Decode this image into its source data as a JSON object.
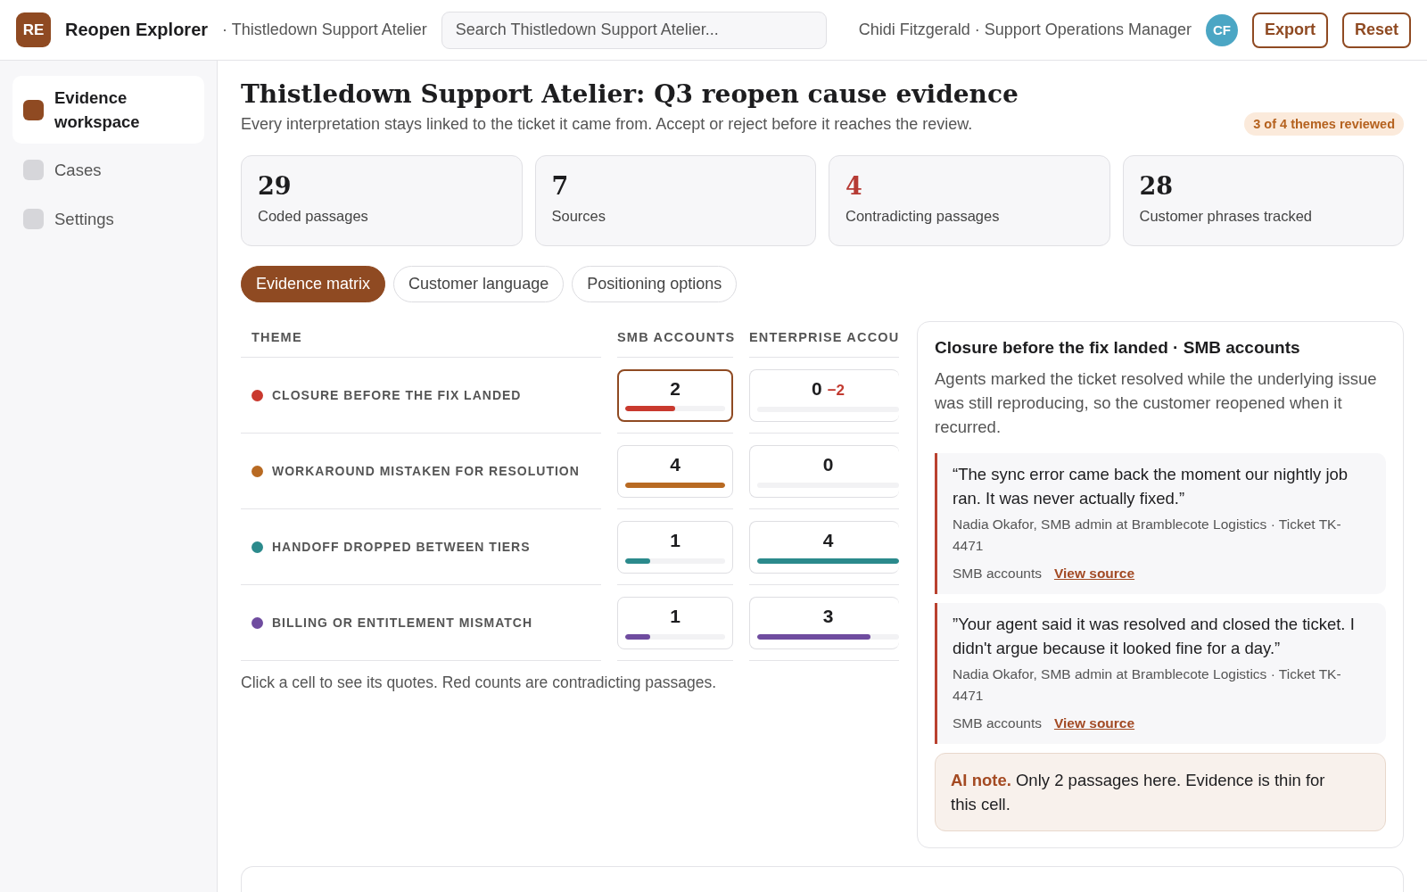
{
  "app": {
    "logo": "RE",
    "name": "Reopen Explorer",
    "workspace": "· Thistledown Support Atelier"
  },
  "search": {
    "placeholder": "Search Thistledown Support Atelier..."
  },
  "user": {
    "label": "Chidi Fitzgerald · Support Operations Manager",
    "initials": "CF"
  },
  "actions": [
    "Export",
    "Reset"
  ],
  "sidebar": {
    "items": [
      {
        "label": "Evidence workspace",
        "selected": true
      },
      {
        "label": "Cases",
        "selected": false
      },
      {
        "label": "Settings",
        "selected": false
      }
    ]
  },
  "page": {
    "title": "Thistledown Support Atelier: Q3 reopen cause evidence",
    "subtitle": "Every interpretation stays linked to the ticket it came from. Accept or reject before it reaches the review.",
    "badge": "3 of 4 themes reviewed"
  },
  "stats": [
    {
      "value": "29",
      "label": "Coded passages",
      "alert": false
    },
    {
      "value": "7",
      "label": "Sources",
      "alert": false
    },
    {
      "value": "4",
      "label": "Contradicting passages",
      "alert": true
    },
    {
      "value": "28",
      "label": "Customer phrases tracked",
      "alert": false
    }
  ],
  "tabs": [
    {
      "label": "Evidence matrix",
      "selected": true
    },
    {
      "label": "Customer language",
      "selected": false
    },
    {
      "label": "Positioning options",
      "selected": false
    }
  ],
  "matrix": {
    "columns": [
      "THEME",
      "SMB ACCOUNTS",
      "ENTERPRISE ACCOU"
    ],
    "rows": [
      {
        "color": "#c9392e",
        "cells": [
          {
            "kind": "theme",
            "text": "CLOSURE BEFORE THE FIX LANDED"
          },
          {
            "kind": "count",
            "count": "2",
            "level": 0.5,
            "selected": true
          },
          {
            "kind": "count",
            "count": "0",
            "contradiction": "−2",
            "selected": false
          }
        ]
      },
      {
        "color": "#b86a22",
        "cells": [
          {
            "kind": "theme",
            "text": "WORKAROUND MISTAKEN FOR RESOLUTION"
          },
          {
            "kind": "count",
            "count": "4",
            "level": 1,
            "selected": false
          },
          {
            "kind": "count",
            "count": "0",
            "selected": false
          }
        ]
      },
      {
        "color": "#2b8a8c",
        "cells": [
          {
            "kind": "theme",
            "text": "HANDOFF DROPPED BETWEEN TIERS"
          },
          {
            "kind": "count",
            "count": "1",
            "level": 0.25,
            "selected": false
          },
          {
            "kind": "count",
            "count": "4",
            "level": 1,
            "selected": false
          }
        ]
      },
      {
        "color": "#6f4c9f",
        "cells": [
          {
            "kind": "theme",
            "text": "BILLING OR ENTITLEMENT MISMATCH"
          },
          {
            "kind": "count",
            "count": "1",
            "level": 0.25,
            "selected": false
          },
          {
            "kind": "count",
            "count": "3",
            "level": 0.8,
            "selected": false
          }
        ]
      }
    ],
    "note": "Click a cell to see its quotes. Red counts are contradicting passages."
  },
  "detail": {
    "title": "Closure before the fix landed · SMB accounts",
    "summary": "Agents marked the ticket resolved while the underlying issue was still reproducing, so the customer reopened when it recurred.",
    "quotes": [
      {
        "text": "“The sync error came back the moment our nightly job ran. It was never actually fixed.”",
        "source": "Nadia Okafor, SMB admin at Bramblecote Logistics · Ticket TK-4471",
        "segment": "SMB accounts",
        "link": "View source"
      },
      {
        "text": "”Your agent said it was resolved and closed the ticket. I didn't argue because it looked fine for a day.”",
        "source": "Nadia Okafor, SMB admin at Bramblecote Logistics · Ticket TK-4471",
        "segment": "SMB accounts",
        "link": "View source"
      }
    ],
    "ai_note": "**AI note.** Only 2 passages here. Evidence is thin for this cell."
  }
}
